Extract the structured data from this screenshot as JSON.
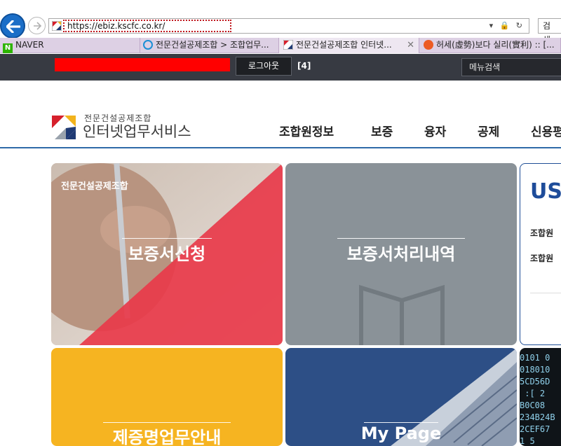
{
  "browser": {
    "url": "https://ebiz.kscfc.co.kr/",
    "search_label": "검색...",
    "tabs": [
      {
        "label": "NAVER",
        "active": false
      },
      {
        "label": "전문건설공제조합 > 조합업무...",
        "active": false
      },
      {
        "label": "전문건설공제조합 인터넷...",
        "active": true
      },
      {
        "label": "허세(虛勢)보다 실리(實利) :: [...",
        "active": false
      }
    ]
  },
  "topbar": {
    "logout_label": "로그아웃",
    "count": "[4]",
    "menu_search_placeholder": "메뉴검색"
  },
  "logo": {
    "org": "전문건설공제조합",
    "service": "인터넷업무서비스"
  },
  "nav": {
    "items": [
      "조합원정보",
      "보증",
      "융자",
      "공제",
      "신용평"
    ]
  },
  "tiles": {
    "guarantee_apply": {
      "org": "전문건설공제조합",
      "label": "보증서신청"
    },
    "guarantee_history": {
      "label": "보증서처리내역"
    },
    "usi": {
      "title": "USI",
      "lines": [
        "조합원",
        "조합원"
      ]
    },
    "exemption": {
      "label": "제증명업무안내"
    },
    "mypage": {
      "label": "My Page"
    },
    "matrix_text": "0101 0\n018010\n5CD56D\n :[ 2\nB0C08\n234B24B\n2CEF67\n1 5"
  },
  "colors": {
    "topbar": "#373a42",
    "nav_line": "#2f6aa8",
    "tile_yellow": "#f6b421",
    "tile_blue": "#2d4f86",
    "tile_red": "#e8394a"
  }
}
